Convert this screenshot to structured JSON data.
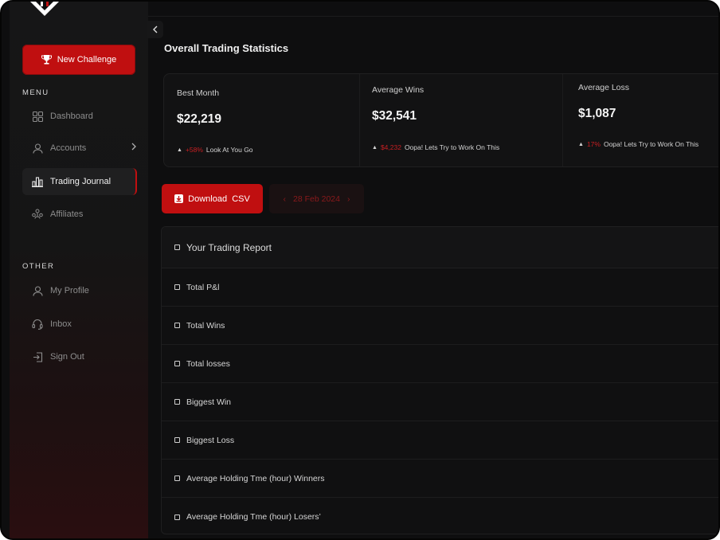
{
  "sidebar": {
    "new_challenge_label": "New Challenge",
    "menu_title": "MENU",
    "menu_items": [
      {
        "label": "Dashboard"
      },
      {
        "label": "Accounts"
      },
      {
        "label": "Trading Journal"
      },
      {
        "label": "Affiliates"
      }
    ],
    "other_title": "OTHER",
    "other_items": [
      {
        "label": "My Profile"
      },
      {
        "label": "Inbox"
      },
      {
        "label": "Sign Out"
      }
    ]
  },
  "header": {
    "title": "Overall Trading Statistics"
  },
  "stats": [
    {
      "label": "Best Month",
      "value": "$22,219",
      "change": "+58%",
      "note": "Look At You Go"
    },
    {
      "label": "Average Wins",
      "value": "$32,541",
      "change": "$4,232",
      "note": "Oopa! Lets Try to Work On This"
    },
    {
      "label": "Average Loss",
      "value": "$1,087",
      "change": "17%",
      "note": "Oopa! Lets Try to Work On This"
    }
  ],
  "actions": {
    "download_label": "Download  CSV",
    "date_label": "28 Feb 2024"
  },
  "report": {
    "title": "Your Trading Report",
    "rows": [
      "Total P&l",
      "Total Wins",
      "Total losses",
      "Biggest Win",
      "Biggest Loss",
      "Average Holding Tme (hour) Winners",
      "Average Holding Tme (hour) Losers’"
    ]
  },
  "colors": {
    "accent": "#c00f10",
    "background": "#0e0e0f",
    "negative": "#c81f22"
  },
  "icons": [
    "trophy-icon",
    "dashboard-grid-icon",
    "user-icon",
    "chevron-right-icon",
    "bar-chart-icon",
    "affiliates-icon",
    "profile-icon",
    "headset-icon",
    "sign-out-icon",
    "chevron-left-icon",
    "download-icon",
    "checkbox-icon"
  ]
}
